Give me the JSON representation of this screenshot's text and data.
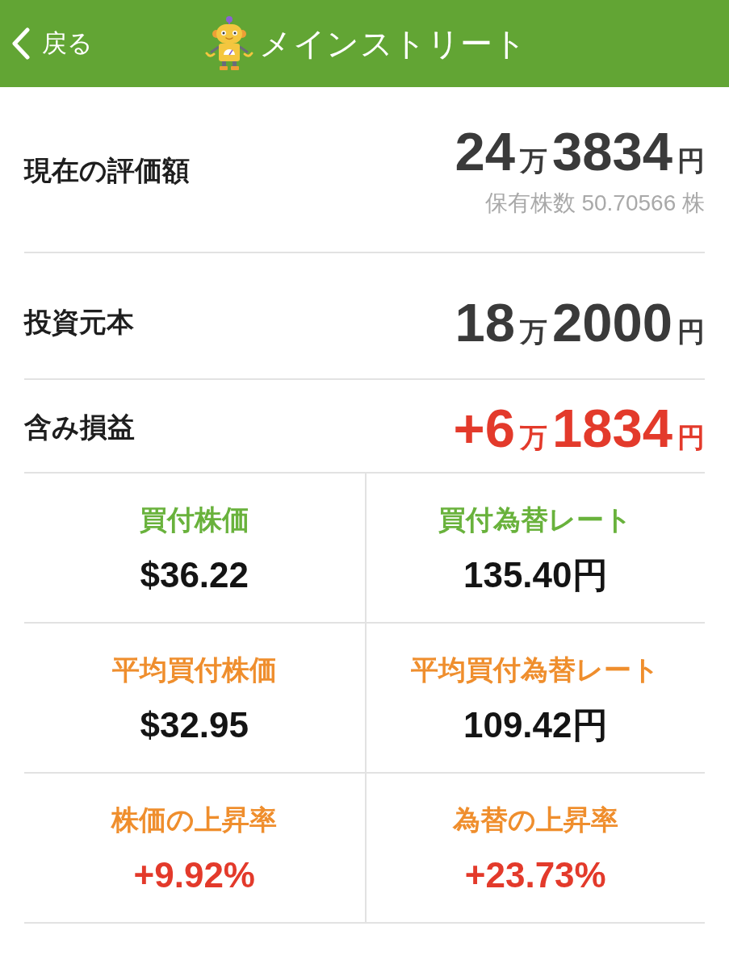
{
  "header": {
    "back_label": "戻る",
    "title": "メインストリート"
  },
  "summary": [
    {
      "label": "現在の評価額",
      "kind": "plain",
      "amount": [
        {
          "text": "24",
          "kind": "digits"
        },
        {
          "text": "万",
          "kind": "unit"
        },
        {
          "text": "3834",
          "kind": "digits"
        },
        {
          "text": "円",
          "kind": "unit"
        }
      ],
      "note": "保有株数 50.70566 株"
    },
    {
      "label": "投資元本",
      "kind": "plain",
      "amount": [
        {
          "text": "18",
          "kind": "digits"
        },
        {
          "text": "万",
          "kind": "unit"
        },
        {
          "text": "2000",
          "kind": "digits"
        },
        {
          "text": "円",
          "kind": "unit"
        }
      ]
    },
    {
      "label": "含み損益",
      "kind": "gain",
      "amount": [
        {
          "text": "+6",
          "kind": "digits"
        },
        {
          "text": "万",
          "kind": "unit"
        },
        {
          "text": "1834",
          "kind": "digits"
        },
        {
          "text": "円",
          "kind": "unit"
        }
      ]
    }
  ],
  "stats": [
    {
      "label": "買付株価",
      "value": "$36.22",
      "kind": "purchase"
    },
    {
      "label": "買付為替レート",
      "value": "135.40円",
      "kind": "purchase"
    },
    {
      "label": "平均買付株価",
      "value": "$32.95",
      "kind": "average"
    },
    {
      "label": "平均買付為替レート",
      "value": "109.42円",
      "kind": "average"
    },
    {
      "label": "株価の上昇率",
      "value": "+9.92%",
      "kind": "rate"
    },
    {
      "label": "為替の上昇率",
      "value": "+23.73%",
      "kind": "rate"
    }
  ]
}
